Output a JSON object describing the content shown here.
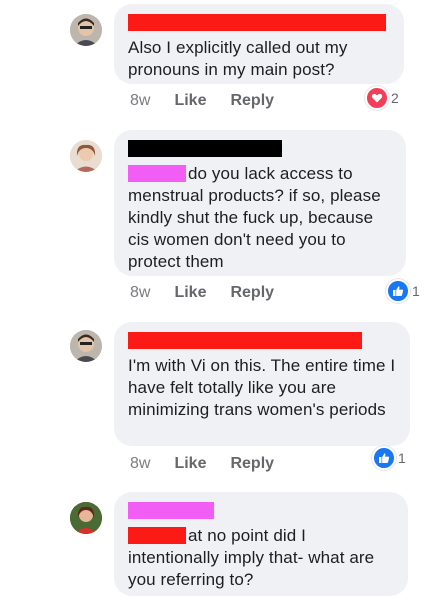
{
  "colors": {
    "redact_red": "#fb1a15",
    "redact_black": "#000000",
    "redact_pink": "#f25df5",
    "bubble_bg": "#f0f1f4",
    "love_red": "#f33e58",
    "like_blue": "#1877f2"
  },
  "comments": [
    {
      "text": "Also I explicitly called out my pronouns in my main post?",
      "age": "8w",
      "like_label": "Like",
      "reply_label": "Reply",
      "reaction_icon": "heart-icon",
      "reaction_count": "2"
    },
    {
      "text": "do you lack access to menstrual products? if so, please kindly shut the fuck up, because cis women don't need you to protect them",
      "age": "8w",
      "like_label": "Like",
      "reply_label": "Reply",
      "reaction_icon": "thumbs-up-icon",
      "reaction_count": "1"
    },
    {
      "text": "I'm with Vi on this. The entire time I have felt totally like you are minimizing trans women's periods",
      "age": "8w",
      "like_label": "Like",
      "reply_label": "Reply",
      "reaction_icon": "thumbs-up-icon",
      "reaction_count": "1"
    },
    {
      "text": "at no point did I intentionally imply that- what are you referring to?"
    }
  ]
}
